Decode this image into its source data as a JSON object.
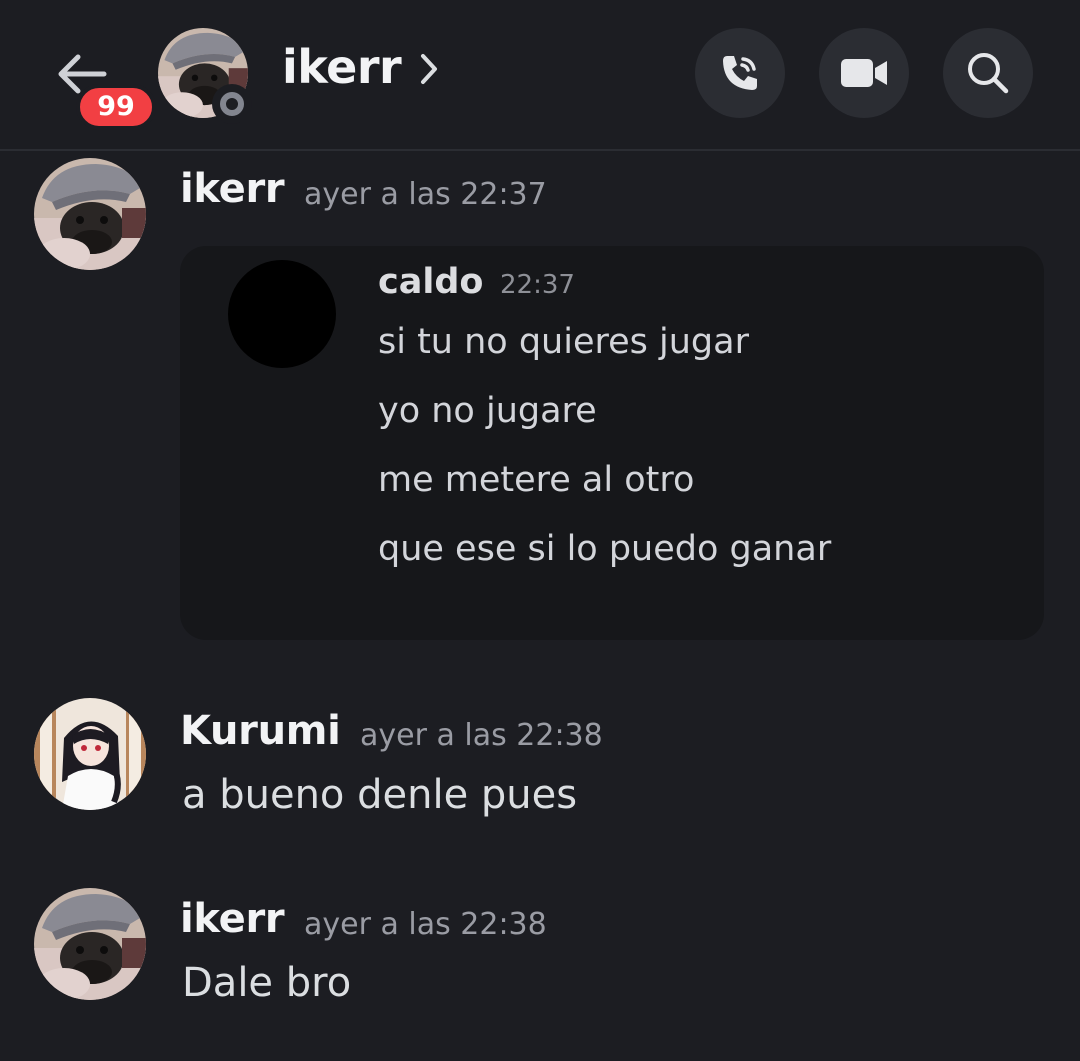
{
  "header": {
    "unread_badge": "99",
    "channel_name": "ikerr",
    "chevron": "›",
    "icons": {
      "back": "arrow-left-icon",
      "call": "phone-call-icon",
      "video": "video-camera-icon",
      "search": "search-icon"
    }
  },
  "messages": [
    {
      "author": "ikerr",
      "timestamp": "ayer a las 22:37",
      "embed": {
        "author": "caldo",
        "time": "22:37",
        "lines": [
          "si tu no quieres jugar",
          "yo no jugare",
          "me metere al otro",
          "que ese si lo puedo ganar"
        ]
      }
    },
    {
      "author": "Kurumi",
      "timestamp": "ayer a las 22:38",
      "text": "a bueno denle pues"
    },
    {
      "author": "ikerr",
      "timestamp": "ayer a las 22:38",
      "text": "Dale bro"
    }
  ],
  "colors": {
    "background": "#1c1d22",
    "badge": "#f23f43",
    "button_bg": "#2b2d33",
    "timestamp": "#9a9ca4"
  }
}
